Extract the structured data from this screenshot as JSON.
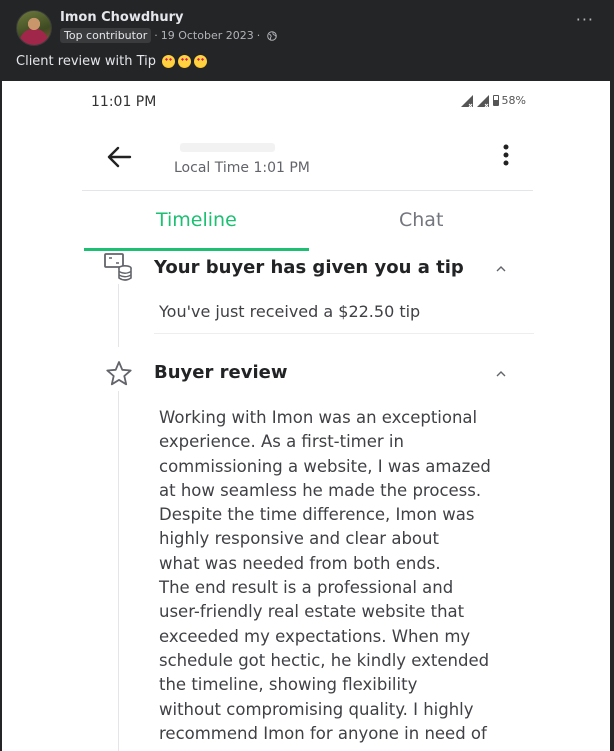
{
  "post": {
    "author": "Imon Chowdhury",
    "badge": "Top contributor",
    "separator": "·",
    "date": "19 October 2023",
    "date_suffix": "·",
    "privacy_icon": "globe-icon",
    "more_label": "···",
    "caption": "Client review with Tip",
    "caption_emojis": [
      "star-struck-emoji",
      "smiling-face-with-hearts-emoji",
      "star-struck-emoji"
    ]
  },
  "phone": {
    "status": {
      "time": "11:01 PM",
      "battery": "58%"
    },
    "header": {
      "local_time": "Local Time 1:01 PM"
    },
    "tabs": [
      {
        "label": "Timeline",
        "active": true
      },
      {
        "label": "Chat",
        "active": false
      }
    ],
    "accent_color": "#1dbf73",
    "events": [
      {
        "title": "Your buyer has given you a tip",
        "icon": "tip-money-icon",
        "body": "You've just received a $22.50 tip"
      },
      {
        "title": "Buyer review",
        "icon": "star-icon",
        "lines": [
          "Working with Imon was an exceptional",
          "experience. As a first-timer in",
          "commissioning a website, I was amazed",
          "at how seamless he made the process.",
          "Despite the time difference, Imon was",
          "highly responsive and clear about",
          "what was needed from both ends.",
          "The end result is a professional and",
          "user-friendly real estate website that",
          "exceeded my expectations. When my",
          "schedule got hectic, he kindly extended",
          "the timeline, showing flexibility",
          "without compromising quality. I highly",
          "recommend Imon for anyone in need of"
        ]
      }
    ]
  }
}
